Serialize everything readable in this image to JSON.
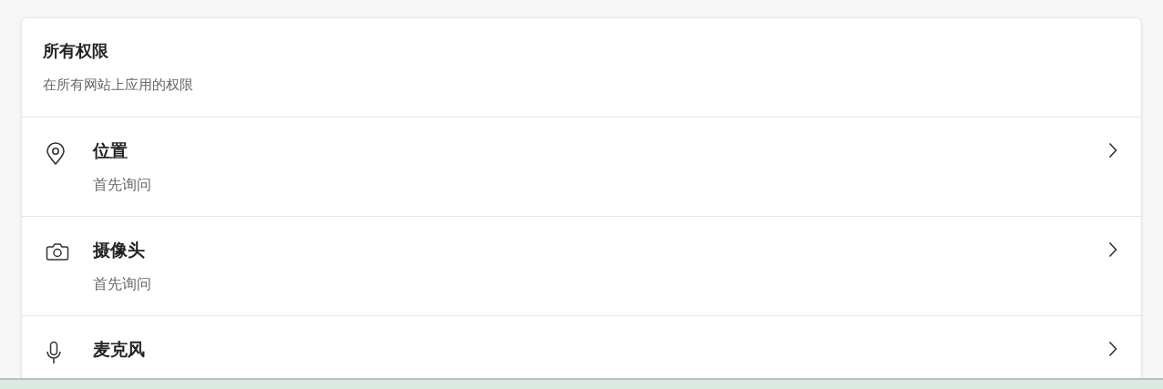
{
  "section": {
    "title": "所有权限",
    "subtitle": "在所有网站上应用的权限"
  },
  "permissions": [
    {
      "kind": "location",
      "title": "位置",
      "subtitle": "首先询问"
    },
    {
      "kind": "camera",
      "title": "摄像头",
      "subtitle": "首先询问"
    },
    {
      "kind": "microphone",
      "title": "麦克风"
    }
  ]
}
